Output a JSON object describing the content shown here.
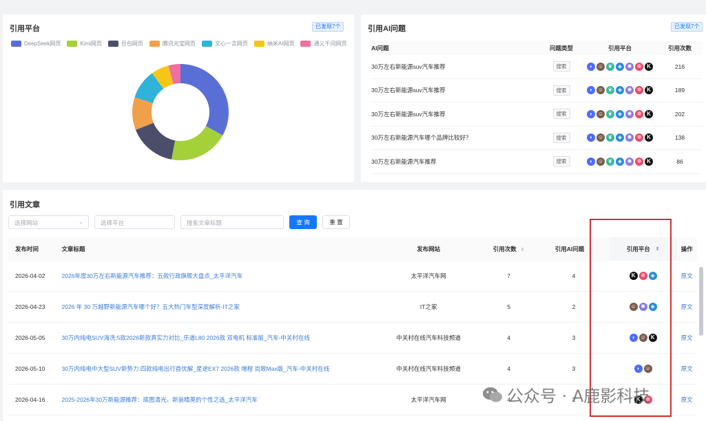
{
  "platforms_panel": {
    "title": "引用平台",
    "badge": "已发现7个",
    "legend": [
      {
        "label": "DeepSeek网页",
        "color": "#5a6fd6"
      },
      {
        "label": "Kimi网页",
        "color": "#a4d03a"
      },
      {
        "label": "豆包网页",
        "color": "#4a4e6b"
      },
      {
        "label": "腾讯元宝网页",
        "color": "#f0a04b"
      },
      {
        "label": "文心一言网页",
        "color": "#2fb3d9"
      },
      {
        "label": "纳米AI网页",
        "color": "#f5c518"
      },
      {
        "label": "通义千问网页",
        "color": "#ef6fa0"
      }
    ],
    "chart_data": {
      "type": "pie",
      "donut": true,
      "categories": [
        "DeepSeek网页",
        "Kimi网页",
        "豆包网页",
        "腾讯元宝网页",
        "文心一言网页",
        "纳米AI网页",
        "通义千问网页"
      ],
      "values": [
        33,
        20,
        16,
        11,
        10,
        6,
        4
      ]
    }
  },
  "questions_panel": {
    "title": "引用AI问题",
    "badge": "已发现7个",
    "columns": [
      "AI问题",
      "问题类型",
      "引用平台",
      "引用次数"
    ],
    "rows": [
      {
        "question": "30万左右新能源suv汽车推荐",
        "type": "搜索",
        "count": "216"
      },
      {
        "question": "30万左右新能源suv汽车推荐",
        "type": "搜索",
        "count": "189"
      },
      {
        "question": "30万左右新能源suv汽车推荐",
        "type": "搜索",
        "count": "202"
      },
      {
        "question": "30万左右新能源汽车哪个品牌比较好？",
        "type": "搜索",
        "count": "138"
      },
      {
        "question": "30万左右新能源汽车推荐",
        "type": "搜索",
        "count": "86"
      }
    ]
  },
  "articles_panel": {
    "title": "引用文章",
    "filters": {
      "site_placeholder": "选择网站",
      "platform_placeholder": "选择平台",
      "search_placeholder": "搜索文章标题",
      "query_label": "查 询",
      "reset_label": "重 置"
    },
    "columns": {
      "date": "发布时间",
      "title": "文章标题",
      "site": "发布网站",
      "count": "引用次数",
      "ai": "引用AI问题",
      "platform": "引用平台",
      "op": "操作"
    },
    "rows": [
      {
        "date": "2026-04-02",
        "title": "2026年度30万左右新能源汽车推荐：五款行政旗舰大盘点_太平洋汽车",
        "site": "太平洋汽车网",
        "count": "7",
        "ai": "4",
        "op": "原文",
        "icons": [
          "kimi",
          "spark",
          "cube"
        ]
      },
      {
        "date": "2026-04-23",
        "title": "2026 年 30 万越野新能源汽车哪个好？五大热门车型深度解析-IT之家",
        "site": "IT之家",
        "count": "5",
        "ai": "2",
        "op": "原文",
        "icons": [
          "face",
          "swirl",
          "cube"
        ]
      },
      {
        "date": "2026-05-05",
        "title": "30万内纯电SUV海洗:5款2026新款真实力对比_乐道L80 2026款 双电机 标准版_汽车-中关村在线",
        "site": "中关村在线汽车科技频道",
        "count": "4",
        "ai": "3",
        "op": "原文",
        "icons": [
          "whale",
          "face",
          "kimi"
        ]
      },
      {
        "date": "2026-05-10",
        "title": "30万内纯电中大型SUV新势力:四款纯电出行首优解_星途EX7 2026款 增程 尚致Max版_汽车-中关村在线",
        "site": "中关村在线汽车科技频道",
        "count": "4",
        "ai": "3",
        "op": "原文",
        "icons": [
          "whale",
          "face"
        ]
      },
      {
        "date": "2026-04-16",
        "title": "2025-2026年30万新能源推荐：底图清光，新装精英的个性之选_太平洋汽车",
        "site": "太平洋汽车网",
        "count": "4",
        "ai": "2",
        "op": "原文",
        "icons": [
          "kimi",
          "spark"
        ]
      }
    ]
  },
  "question_platform_icons": [
    "whale",
    "face",
    "leaf",
    "cube",
    "swirl",
    "spark",
    "kimi"
  ],
  "watermark": {
    "text": "公众号 · A鹿影科技"
  }
}
